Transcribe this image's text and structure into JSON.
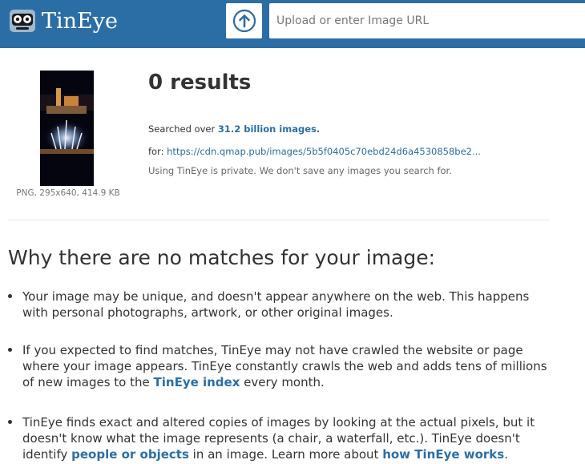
{
  "header": {
    "logo_text": "TinEye",
    "upload_icon": "upload-arrow-icon",
    "search_placeholder": "Upload or enter Image URL",
    "colors": {
      "header_bg": "#2b6ea5",
      "link": "#2b6ea5"
    }
  },
  "result": {
    "thumbnail_meta": "PNG, 295x640, 414.9 KB",
    "title": "0 results",
    "searched_prefix": "Searched over ",
    "searched_count": "31.2 billion images.",
    "for_prefix": "for: ",
    "for_url": "https://cdn.qmap.pub/images/5b5f0405c70ebd24d6a4530858be2...",
    "private_note": "Using TinEye is private. We don't save any images you search for."
  },
  "why": {
    "title": "Why there are no matches for your image:",
    "reason1": "Your image may be unique, and doesn't appear anywhere on the web. This happens with personal photographs, artwork, or other original images.",
    "reason2_text": "If you expected to find matches, TinEye may not have crawled the website or page where your image appears. TinEye constantly crawls the web and adds tens of millions of new images to the ",
    "reason2_link": "TinEye index",
    "reason2_tail": " every month.",
    "reason3_text": "TinEye finds exact and altered copies of images by looking at the actual pixels, but it doesn't know what the image represents (a chair, a waterfall, etc.). TinEye doesn't identify ",
    "reason3_link1": "people or objects",
    "reason3_mid": " in an image. Learn more about ",
    "reason3_link2": "how TinEye works",
    "reason3_tail": "."
  }
}
